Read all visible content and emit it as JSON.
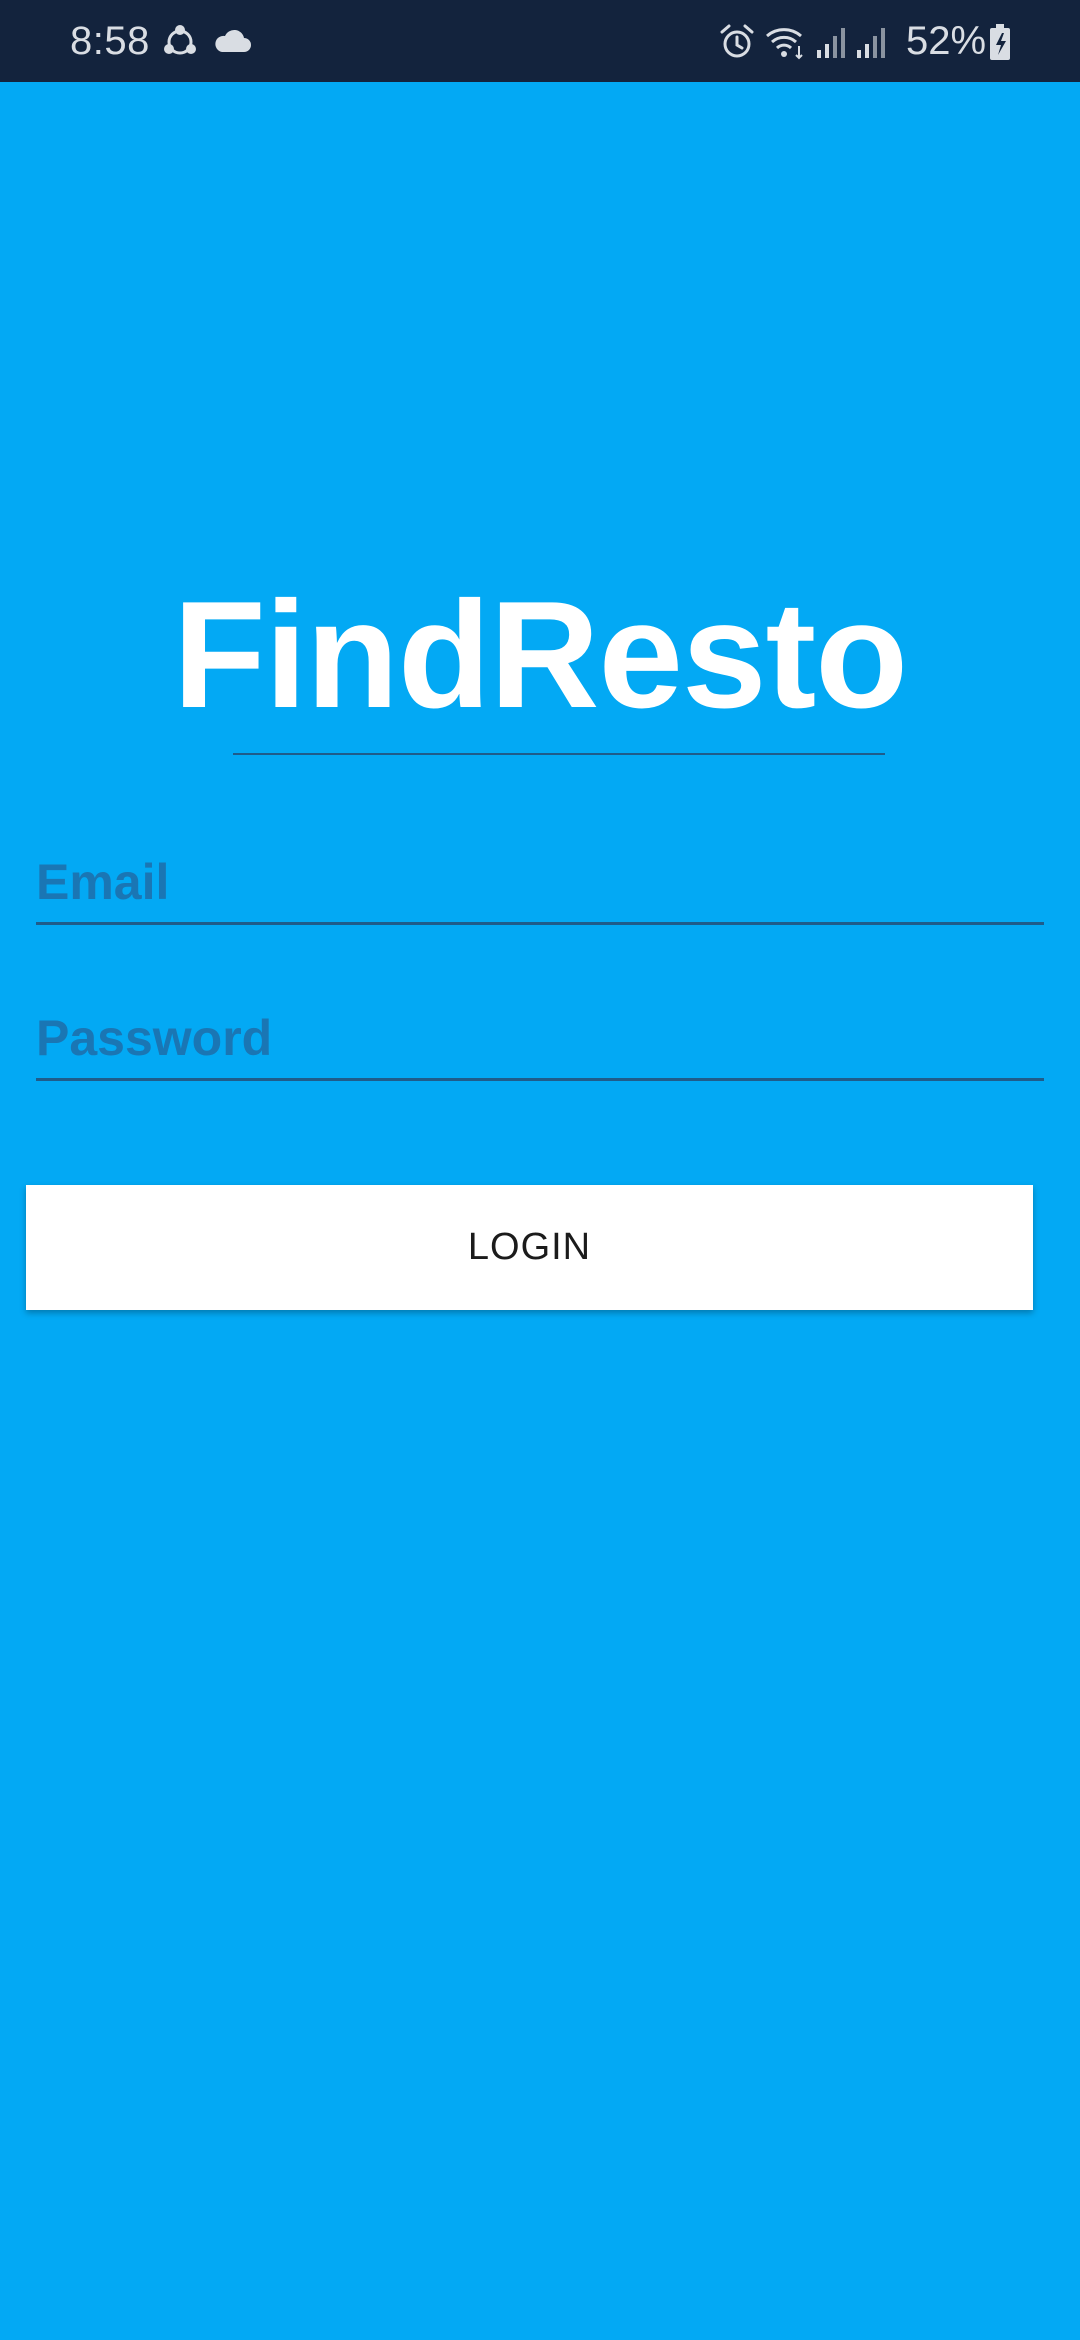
{
  "status_bar": {
    "time": "8:58",
    "battery_percent": "52%",
    "icons_left": [
      "sync-icon",
      "cloud-icon"
    ],
    "icons_right": [
      "alarm-icon",
      "wifi-icon",
      "signal-icon",
      "signal-icon",
      "battery-charging-icon"
    ]
  },
  "app": {
    "title": "FindResto"
  },
  "form": {
    "email_placeholder": "Email",
    "password_placeholder": "Password",
    "login_label": "LOGIN"
  },
  "colors": {
    "background": "#03a9f4",
    "status_bar": "#13233d",
    "title": "#ffffff",
    "field_label": "#1a76b4",
    "field_underline": "#1f5c8a",
    "button_background": "#ffffff",
    "button_text": "#1b1b1b"
  }
}
